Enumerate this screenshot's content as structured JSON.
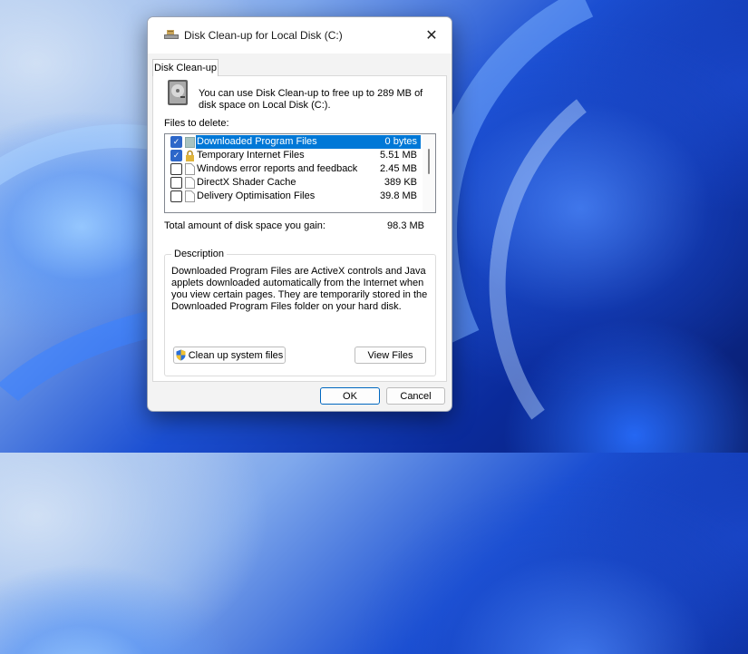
{
  "window": {
    "title": "Disk Clean-up for Local Disk  (C:)",
    "close_glyph": "✕"
  },
  "tab": {
    "label": "Disk Clean-up"
  },
  "intro_text": "You can use Disk Clean-up to free up to 289 MB of disk space on Local Disk  (C:).",
  "files_label": "Files to delete:",
  "files": [
    {
      "name": "Downloaded Program Files",
      "size": "0 bytes",
      "checked": true,
      "selected": true,
      "icon": "folder-icon"
    },
    {
      "name": "Temporary Internet Files",
      "size": "5.51 MB",
      "checked": true,
      "selected": false,
      "icon": "lock-icon"
    },
    {
      "name": "Windows error reports and feedback di...",
      "size": "2.45 MB",
      "checked": false,
      "selected": false,
      "icon": "file-icon"
    },
    {
      "name": "DirectX Shader Cache",
      "size": "389 KB",
      "checked": false,
      "selected": false,
      "icon": "file-icon"
    },
    {
      "name": "Delivery Optimisation Files",
      "size": "39.8 MB",
      "checked": false,
      "selected": false,
      "icon": "file-icon"
    }
  ],
  "total": {
    "label": "Total amount of disk space you gain:",
    "value": "98.3 MB"
  },
  "description": {
    "title": "Description",
    "text": "Downloaded Program Files are ActiveX controls and Java applets downloaded automatically from the Internet when you view certain pages. They are temporarily stored in the Downloaded Program Files folder on your hard disk."
  },
  "buttons": {
    "cleanup_system": "Clean up system files",
    "view_files": "View Files",
    "ok": "OK",
    "cancel": "Cancel"
  },
  "colors": {
    "selection": "#0078d7",
    "checkbox_checked": "#2d67c9",
    "ok_border": "#0067c0"
  }
}
